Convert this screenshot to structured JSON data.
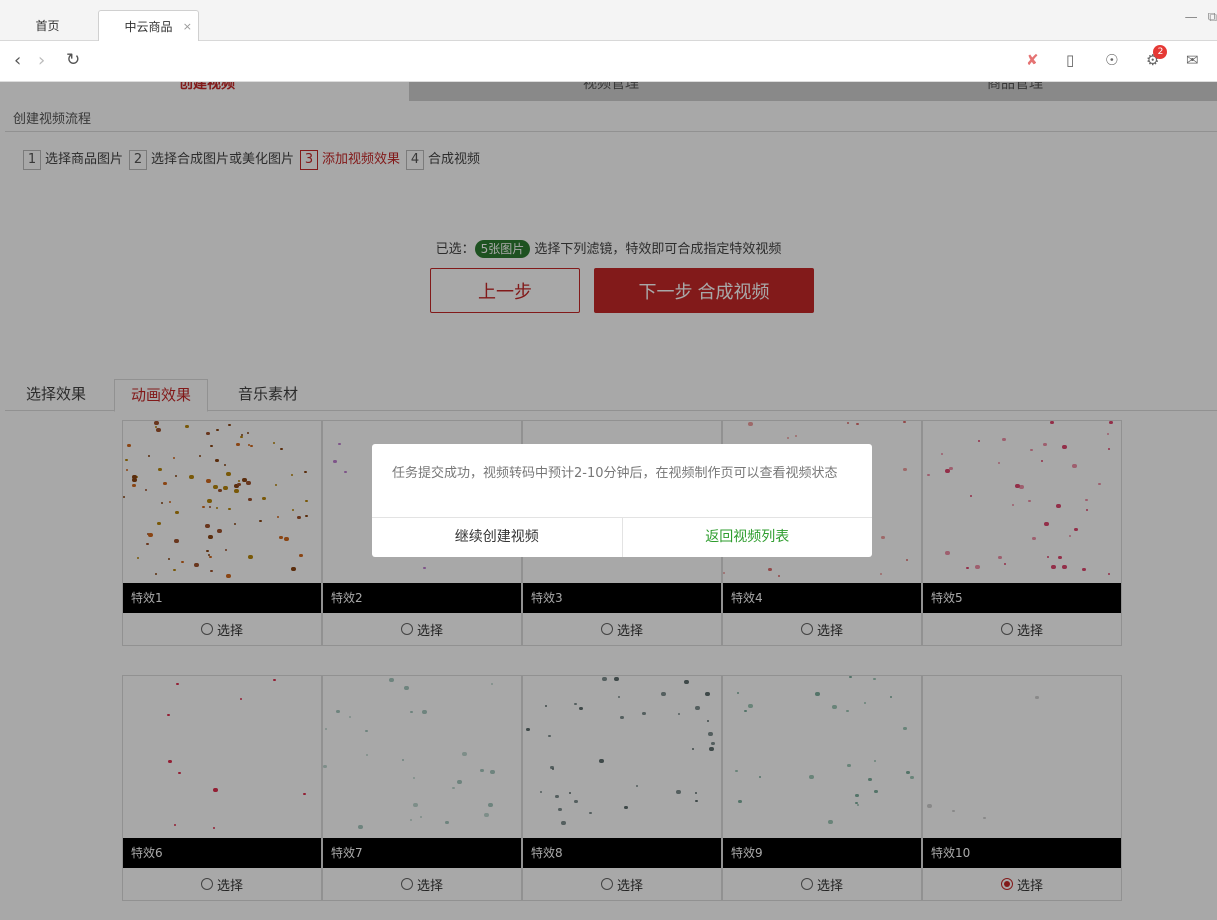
{
  "tabs": {
    "home": "首页",
    "active": "中云商品",
    "close": "×"
  },
  "window": {
    "minimize": "—",
    "restore": "⧉"
  },
  "toolbar": {
    "icons": [
      "attachment-icon",
      "mobile-icon",
      "compass-icon",
      "settings-icon",
      "comment-icon"
    ],
    "badge_count": "2"
  },
  "main_nav": [
    "创建视频",
    "视频管理",
    "商品管理"
  ],
  "flow": {
    "title": "创建视频流程",
    "steps": [
      {
        "num": "1",
        "label": "选择商品图片"
      },
      {
        "num": "2",
        "label": "选择合成图片或美化图片"
      },
      {
        "num": "3",
        "label": "添加视频效果"
      },
      {
        "num": "4",
        "label": "合成视频"
      }
    ]
  },
  "selection": {
    "prefix": "已选：",
    "count": "5张图片",
    "suffix": " 选择下列滤镜，特效即可合成指定特效视频"
  },
  "buttons": {
    "prev": "上一步",
    "next": "下一步 合成视频"
  },
  "subtabs": [
    "选择效果",
    "动画效果",
    "音乐素材"
  ],
  "effects": [
    {
      "name": "特效1",
      "select": "选择",
      "selected": false
    },
    {
      "name": "特效2",
      "select": "选择",
      "selected": false
    },
    {
      "name": "特效3",
      "select": "选择",
      "selected": false
    },
    {
      "name": "特效4",
      "select": "选择",
      "selected": false
    },
    {
      "name": "特效5",
      "select": "选择",
      "selected": false
    },
    {
      "name": "特效6",
      "select": "选择",
      "selected": false
    },
    {
      "name": "特效7",
      "select": "选择",
      "selected": false
    },
    {
      "name": "特效8",
      "select": "选择",
      "selected": false
    },
    {
      "name": "特效9",
      "select": "选择",
      "selected": false
    },
    {
      "name": "特效10",
      "select": "选择",
      "selected": true
    }
  ],
  "dialog": {
    "message": "任务提交成功，视频转码中预计2-10分钟后，在视频制作页可以查看视频状态",
    "continue": "继续创建视频",
    "back_to_list": "返回视频列表"
  },
  "colors": {
    "accent": "#c62828",
    "success": "#2e9d2e",
    "pill": "#2e7d32"
  }
}
